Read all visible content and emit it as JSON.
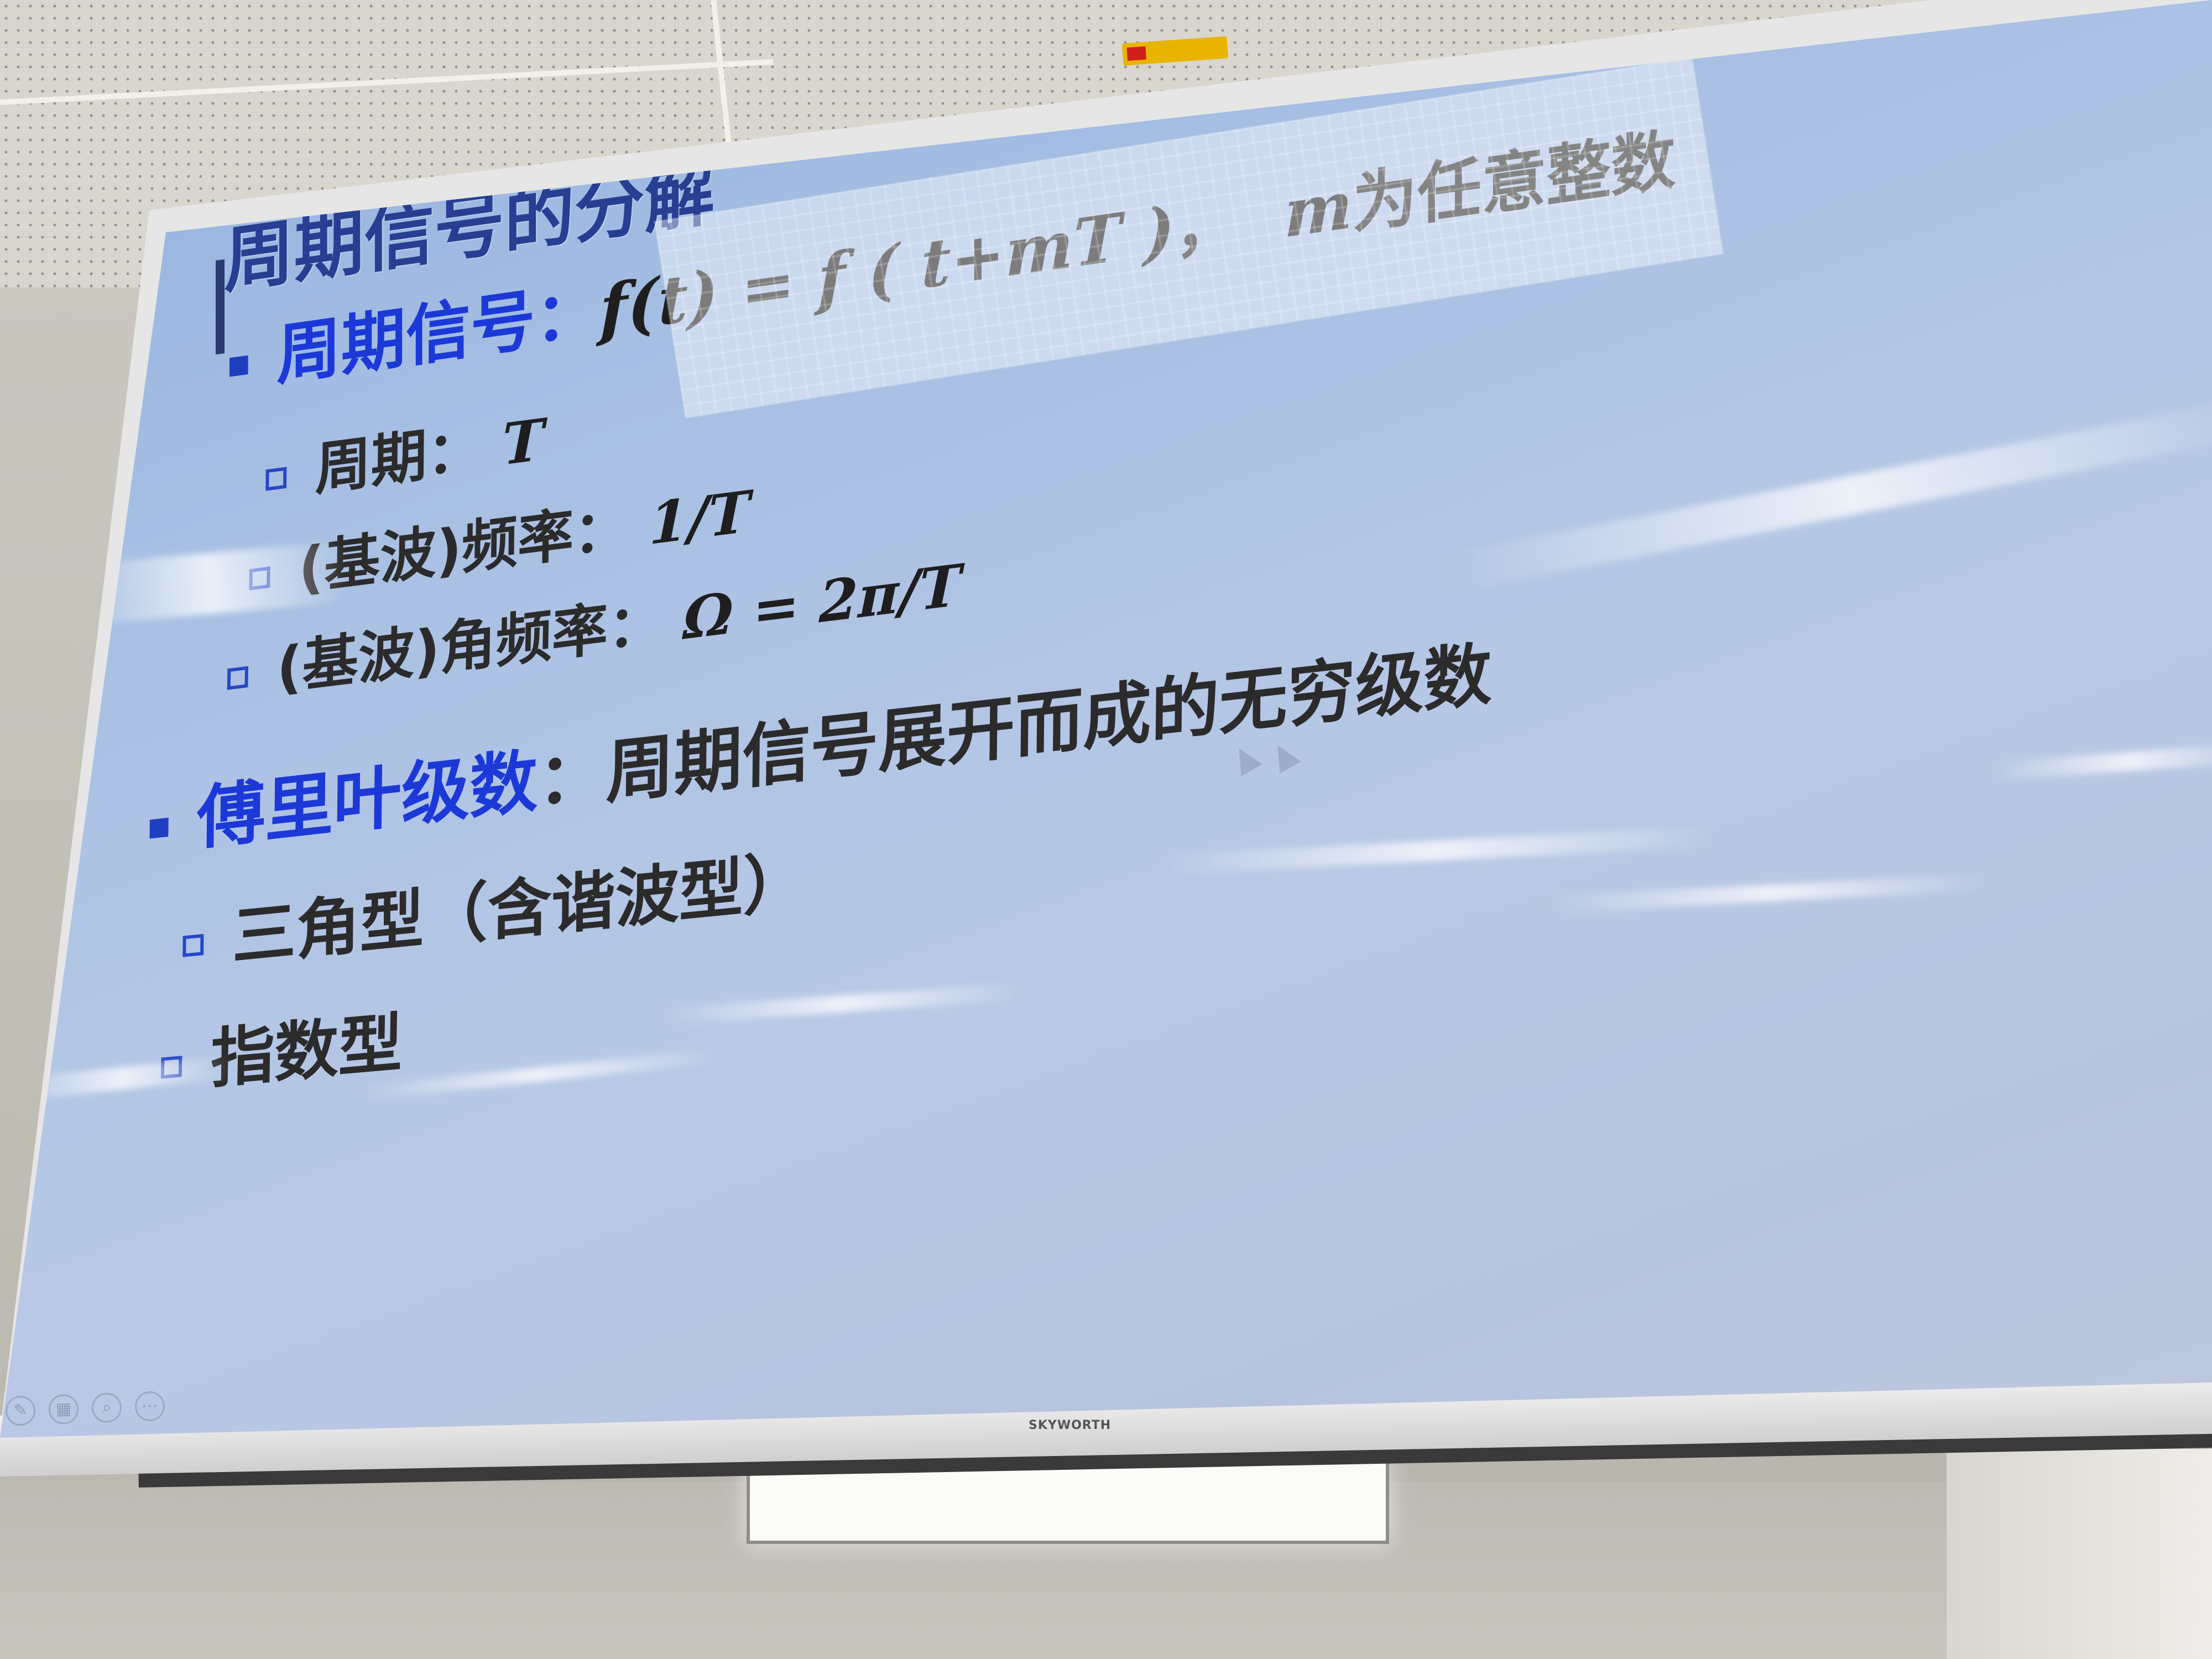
{
  "slide": {
    "title": "周期信号的分解",
    "bullet_periodic": {
      "label": "周期信号：",
      "formula": "f(t) = f ( t+mT )",
      "separator": "，",
      "note_var": "m",
      "note_text": "为任意整数"
    },
    "sub_period": {
      "label": "周期：",
      "value": "T"
    },
    "sub_frequency": {
      "label": "(基波)频率：",
      "value": "1/T"
    },
    "sub_angular": {
      "label": "(基波)角频率：",
      "value": "Ω = 2π/T"
    },
    "bullet_fourier": {
      "label": "傅里叶级数",
      "colon": "：",
      "text": "周期信号展开而成的无穷级数"
    },
    "sub_trig": {
      "label": "三角型（含谐波型）"
    },
    "sub_exp": {
      "label": "指数型"
    }
  },
  "tv": {
    "brand": "SKYWORTH"
  },
  "colors": {
    "title_color": "#273f92",
    "label_blue": "#1c39d8",
    "bullet_blue": "#1f3fc2",
    "text_dark": "#2b2b2b",
    "screen_blue": "#a7bfe3"
  },
  "icons": [
    "square-bullet-icon",
    "hollow-square-bullet-icon",
    "mouse-cursor-icon"
  ]
}
